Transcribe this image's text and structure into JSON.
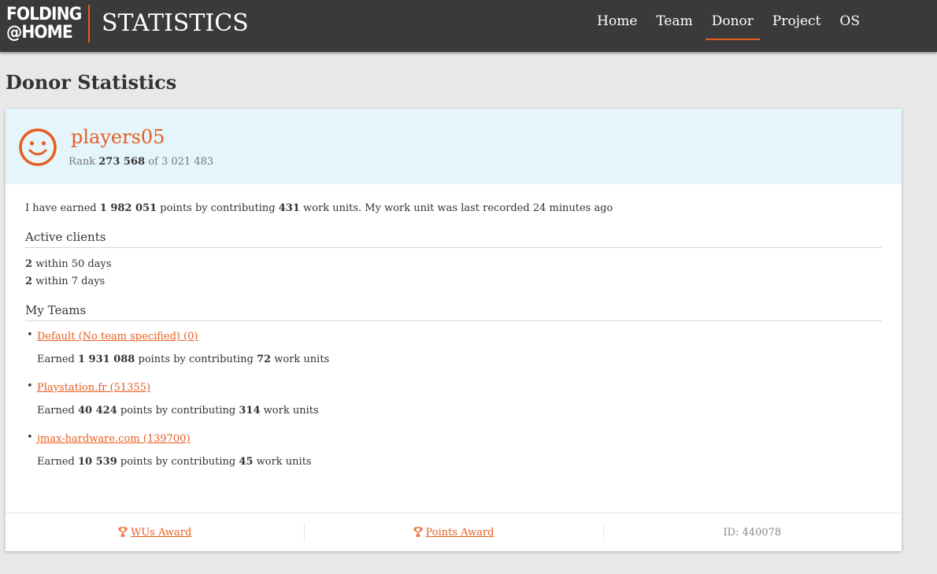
{
  "header": {
    "logo_line1": "FOLDING",
    "logo_line2": "@HOME",
    "brand": "STATISTICS",
    "nav": [
      {
        "label": "Home"
      },
      {
        "label": "Team"
      },
      {
        "label": "Donor",
        "active": true
      },
      {
        "label": "Project"
      },
      {
        "label": "OS"
      }
    ],
    "accent_color": "#e85d1e"
  },
  "page": {
    "title": "Donor Statistics"
  },
  "donor": {
    "name": "players05",
    "rank_label": "Rank",
    "rank": "273 568",
    "of_label": "of",
    "total": "3 021 483",
    "avatar_icon": "smiley-icon"
  },
  "summary": {
    "t1": "I have earned",
    "points": "1 982 051",
    "t2": "points by contributing",
    "wus": "431",
    "t3": "work units. My work unit was last recorded 24 minutes ago"
  },
  "active_clients": {
    "title": "Active clients",
    "rows": [
      {
        "count": "2",
        "text": "within 50 days"
      },
      {
        "count": "2",
        "text": "within 7 days"
      }
    ]
  },
  "teams": {
    "title": "My Teams",
    "earned_label": "Earned",
    "points_label": "points by contributing",
    "wus_label": "work units",
    "items": [
      {
        "name": "Default (No team specified) (0)",
        "points": "1 931 088",
        "wus": "72"
      },
      {
        "name": "Playstation.fr (51355)",
        "points": "40 424",
        "wus": "314"
      },
      {
        "name": "jmax-hardware.com (139700)",
        "points": "10 539",
        "wus": "45"
      }
    ]
  },
  "footer": {
    "wus_award": "WUs Award",
    "points_award": "Points Award",
    "id": "ID: 440078",
    "award_icon": "trophy-icon"
  }
}
